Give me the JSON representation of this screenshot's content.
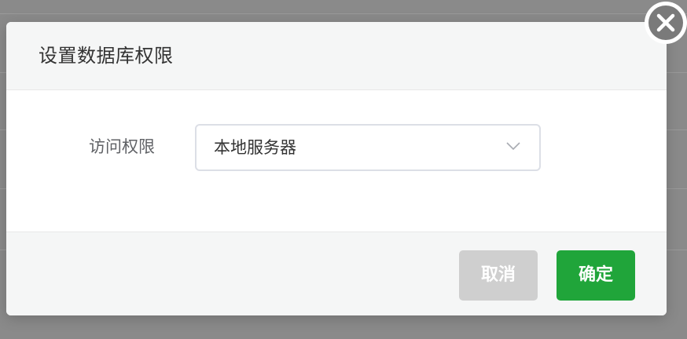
{
  "dialog": {
    "title": "设置数据库权限",
    "field_label": "访问权限",
    "select_value": "本地服务器",
    "cancel_label": "取消",
    "confirm_label": "确定"
  },
  "icons": {
    "close": "close-icon",
    "chevron": "chevron-down-icon"
  },
  "colors": {
    "confirm_button": "#20a53a",
    "cancel_button": "#cfcfcf",
    "backdrop": "#8a8a8a"
  }
}
